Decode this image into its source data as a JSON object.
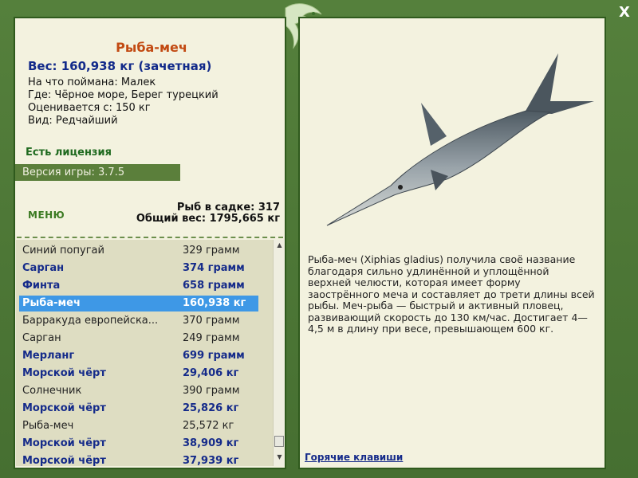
{
  "fish": {
    "title": "Рыба-меч",
    "weight": "Вес: 160,938 кг (зачетная)",
    "info": [
      "На что поймана: Малек",
      "Где: Чёрное море, Берег турецкий",
      "Оценивается с: 150 кг",
      "Вид: Редчайший"
    ],
    "license": "Есть лицензия",
    "version": "Версия игры: 3.7.5"
  },
  "menu": {
    "label": "МЕНЮ"
  },
  "cage": {
    "count": "Рыб в садке: 317",
    "total": "Общий вес: 1795,665 кг"
  },
  "catch_list": [
    {
      "name": "Синий попугай",
      "weight": "329 грамм",
      "style": "normal"
    },
    {
      "name": "Сарган",
      "weight": "374 грамм",
      "style": "bold"
    },
    {
      "name": "Финта",
      "weight": "658 грамм",
      "style": "bold"
    },
    {
      "name": "Рыба-меч",
      "weight": "160,938 кг",
      "style": "selected"
    },
    {
      "name": "Барракуда европейска...",
      "weight": "370 грамм",
      "style": "normal"
    },
    {
      "name": "Сарган",
      "weight": "249 грамм",
      "style": "normal"
    },
    {
      "name": "Мерланг",
      "weight": "699 грамм",
      "style": "bold"
    },
    {
      "name": "Морской чёрт",
      "weight": "29,406 кг",
      "style": "bold"
    },
    {
      "name": "Солнечник",
      "weight": "390 грамм",
      "style": "normal"
    },
    {
      "name": "Морской чёрт",
      "weight": "25,826 кг",
      "style": "bold"
    },
    {
      "name": "Рыба-меч",
      "weight": "25,572 кг",
      "style": "normal"
    },
    {
      "name": "Морской чёрт",
      "weight": "38,909 кг",
      "style": "bold"
    },
    {
      "name": "Морской чёрт",
      "weight": "37,939 кг",
      "style": "bold"
    }
  ],
  "description": "Рыба-меч (Xiphias gladius) получила своё название благодаря сильно удлинённой и уплощённой верхней челюсти, которая имеет форму заострённого меча и составляет до трети длины всей рыбы. Меч-рыба — быстрый и активный пловец, развивающий скорость до 130 км/час. Достигает 4—4,5 м в длину при весе, превышающем 600 кг.",
  "hotkeys": "Горячие клавиши",
  "close_label": "X",
  "icons": {
    "close": "close-icon",
    "logo": "fish-logo-icon",
    "scroll_up": "chevron-up-icon",
    "scroll_down": "chevron-down-icon"
  }
}
